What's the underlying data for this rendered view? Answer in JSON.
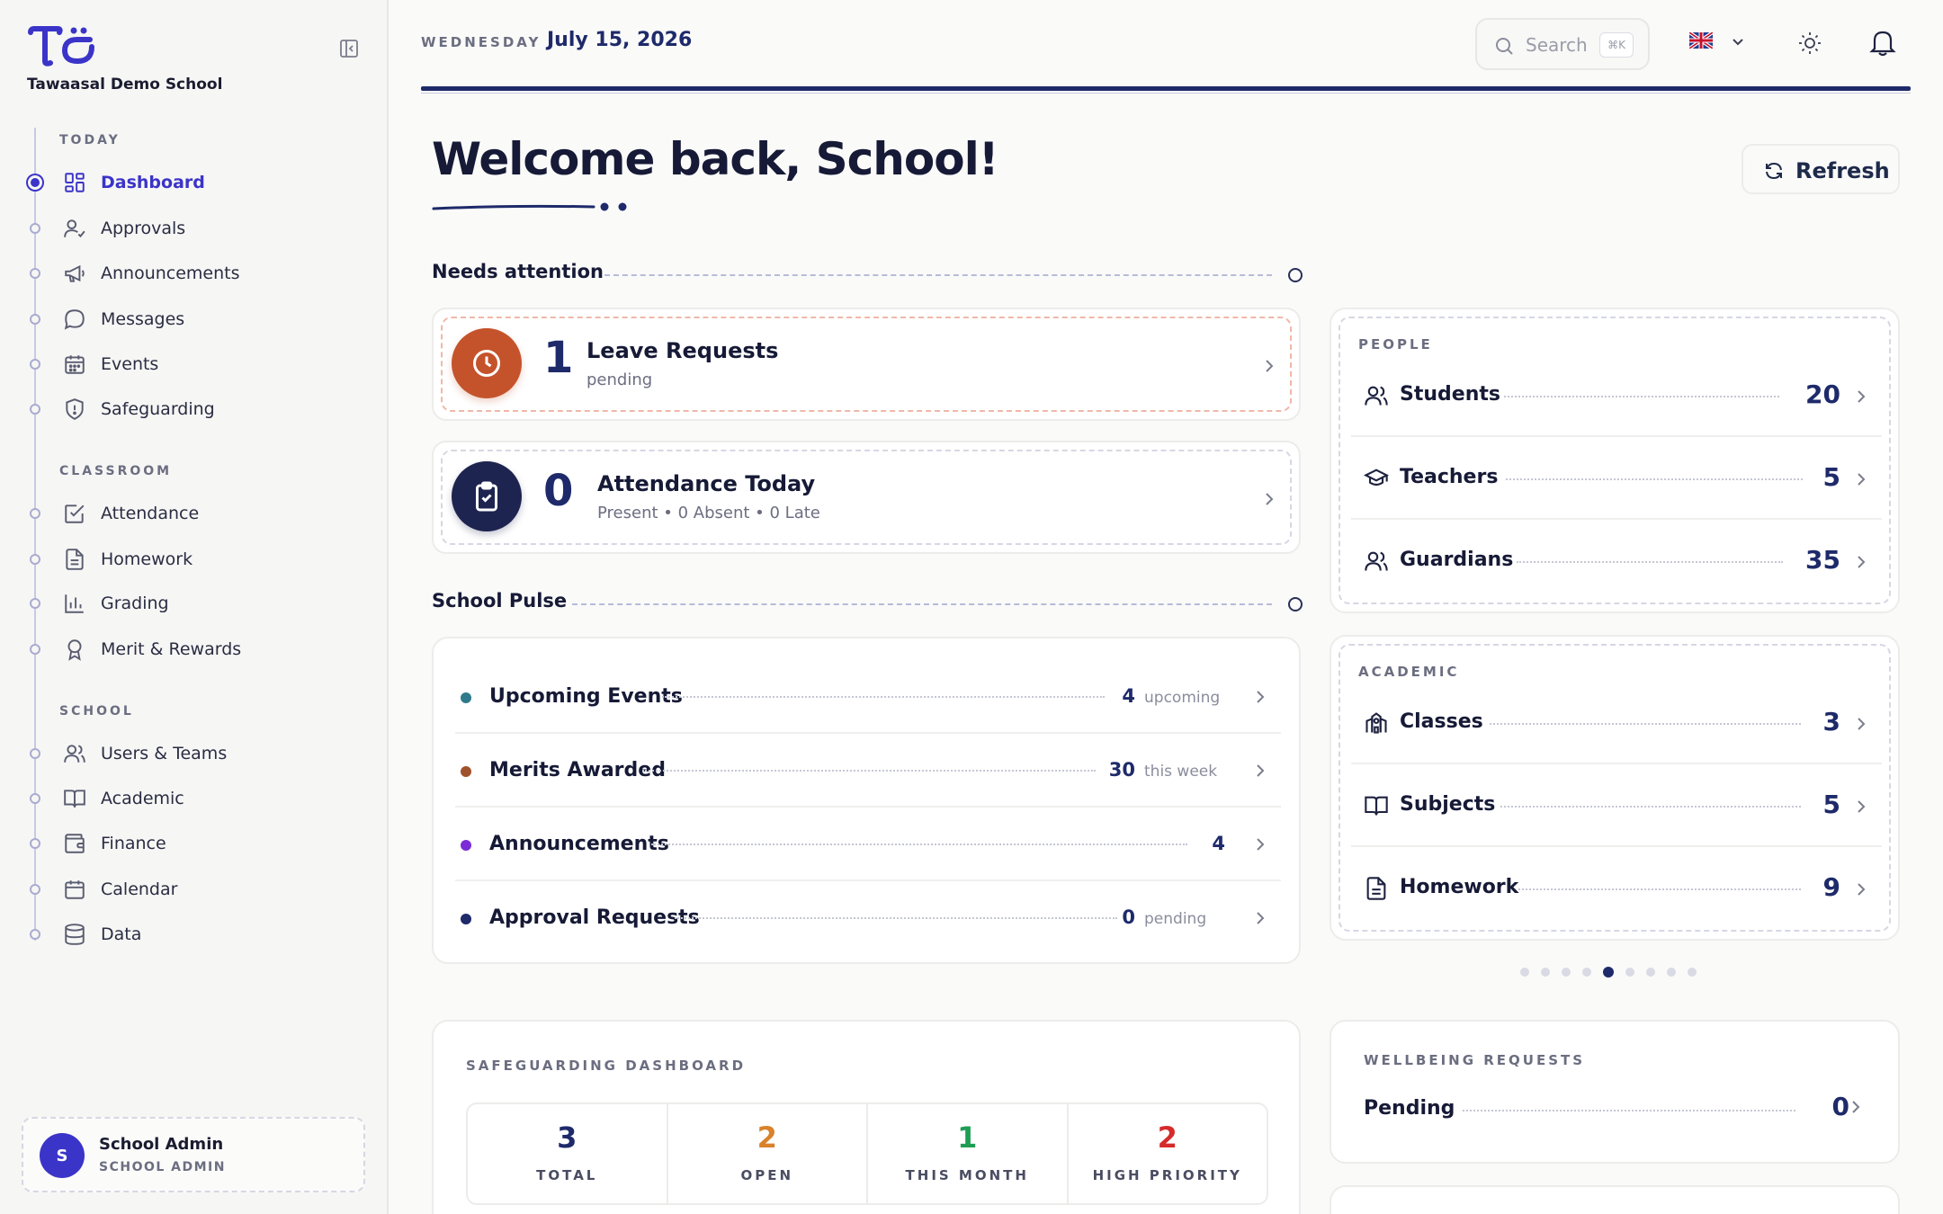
{
  "sidebar": {
    "school_name": "Tawaasal Demo School",
    "sections": {
      "today": "TODAY",
      "classroom": "CLASSROOM",
      "school": "SCHOOL"
    },
    "items": [
      {
        "label": "Dashboard",
        "icon": "dashboard-grid-icon",
        "active": true
      },
      {
        "label": "Approvals",
        "icon": "user-check-icon"
      },
      {
        "label": "Announcements",
        "icon": "megaphone-icon"
      },
      {
        "label": "Messages",
        "icon": "chat-bubble-icon"
      },
      {
        "label": "Events",
        "icon": "calendar-grid-icon"
      },
      {
        "label": "Safeguarding",
        "icon": "shield-alert-icon"
      },
      {
        "label": "Attendance",
        "icon": "checkbox-icon"
      },
      {
        "label": "Homework",
        "icon": "document-icon"
      },
      {
        "label": "Grading",
        "icon": "bar-chart-icon"
      },
      {
        "label": "Merit & Rewards",
        "icon": "award-icon"
      },
      {
        "label": "Users & Teams",
        "icon": "users-icon"
      },
      {
        "label": "Academic",
        "icon": "book-open-icon"
      },
      {
        "label": "Finance",
        "icon": "wallet-icon"
      },
      {
        "label": "Calendar",
        "icon": "calendar-icon"
      },
      {
        "label": "Data",
        "icon": "database-icon"
      }
    ],
    "user": {
      "initial": "S",
      "name": "School Admin",
      "role": "SCHOOL ADMIN"
    }
  },
  "topbar": {
    "day": "WEDNESDAY",
    "date": "July 15, 2026",
    "search_placeholder": "Search",
    "search_shortcut": "⌘K"
  },
  "main": {
    "welcome": "Welcome back, School!",
    "refresh_label": "Refresh",
    "needs_attention": {
      "title": "Needs attention",
      "cards": [
        {
          "count": "1",
          "title": "Leave Requests",
          "subtitle": "pending",
          "color": "#c4532c"
        },
        {
          "count": "0",
          "title": "Attendance Today",
          "subtitle": "Present • 0 Absent • 0 Late",
          "color": "#1e2450"
        }
      ]
    },
    "school_pulse": {
      "title": "School Pulse",
      "rows": [
        {
          "label": "Upcoming Events",
          "value": "4",
          "unit": "upcoming",
          "dot": "#2f7a8c"
        },
        {
          "label": "Merits Awarded",
          "value": "30",
          "unit": "this week",
          "dot": "#a0522d"
        },
        {
          "label": "Announcements",
          "value": "4",
          "unit": "",
          "dot": "#7b2cd6"
        },
        {
          "label": "Approval Requests",
          "value": "0",
          "unit": "pending",
          "dot": "#1e2a6a"
        }
      ]
    },
    "people": {
      "label": "PEOPLE",
      "rows": [
        {
          "name": "Students",
          "value": "20",
          "icon": "users-icon"
        },
        {
          "name": "Teachers",
          "value": "5",
          "icon": "graduation-cap-icon"
        },
        {
          "name": "Guardians",
          "value": "35",
          "icon": "users-icon"
        }
      ]
    },
    "academic": {
      "label": "ACADEMIC",
      "rows": [
        {
          "name": "Classes",
          "value": "3",
          "icon": "school-building-icon"
        },
        {
          "name": "Subjects",
          "value": "5",
          "icon": "book-open-icon"
        },
        {
          "name": "Homework",
          "value": "9",
          "icon": "document-icon"
        }
      ]
    },
    "carousel": {
      "count": 9,
      "active_index": 4
    },
    "safeguarding": {
      "label": "SAFEGUARDING DASHBOARD",
      "stats": [
        {
          "value": "3",
          "label": "TOTAL",
          "color": "#1e2a6a"
        },
        {
          "value": "2",
          "label": "OPEN",
          "color": "#d9822b"
        },
        {
          "value": "1",
          "label": "THIS MONTH",
          "color": "#1f9d55"
        },
        {
          "value": "2",
          "label": "HIGH PRIORITY",
          "color": "#d62b2b"
        }
      ]
    },
    "wellbeing": {
      "label": "WELLBEING REQUESTS",
      "name": "Pending",
      "value": "0"
    }
  }
}
